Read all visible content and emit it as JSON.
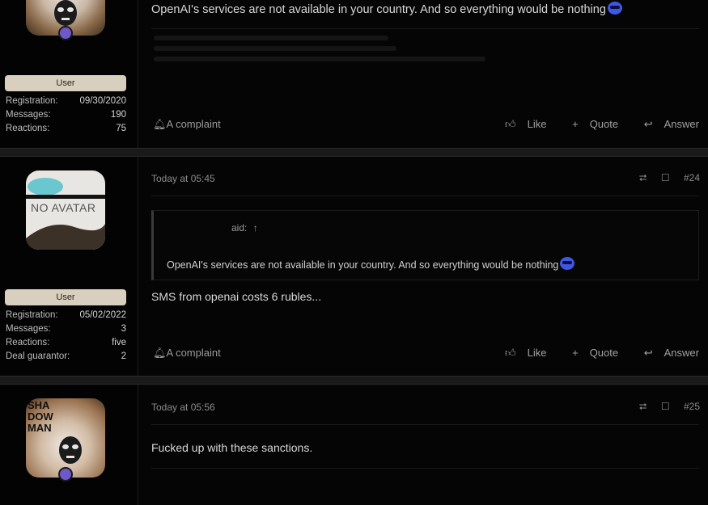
{
  "post1": {
    "text": "OpenAI's services are not available in your country. And so everything would be nothing",
    "badge": "User",
    "stats": [
      {
        "k": "Registration:",
        "v": "09/30/2020"
      },
      {
        "k": "Messages:",
        "v": "190"
      },
      {
        "k": "Reactions:",
        "v": "75"
      }
    ]
  },
  "post2": {
    "avatar_text": "NO AVATAR",
    "date": "Today at 05:45",
    "number": "#24",
    "quote_said": "aid:",
    "quote_text": "OpenAI's services are not available in your country. And so everything would be nothing",
    "text": "SMS from openai costs 6 rubles...",
    "badge": "User",
    "stats": [
      {
        "k": "Registration:",
        "v": "05/02/2022"
      },
      {
        "k": "Messages:",
        "v": "3"
      },
      {
        "k": "Reactions:",
        "v": "five"
      },
      {
        "k": "Deal guarantor:",
        "v": "2"
      }
    ]
  },
  "post3": {
    "avatar_text": "SHA\nDOW\nMAN",
    "date": "Today at 05:56",
    "number": "#25",
    "text": "Fucked up with these sanctions."
  },
  "actions": {
    "complaint": "A complaint",
    "like": "Like",
    "quote": "Quote",
    "answer": "Answer"
  },
  "icons": {
    "share": "share-icon",
    "bookmark": "bookmark-icon",
    "bell": "bell-icon",
    "thumb": "thumbs-up-icon",
    "plus": "plus-icon",
    "reply": "reply-icon",
    "emoji": "sunglasses-emoji"
  },
  "colors": {
    "background": "#000000",
    "badge": "#d9cfbe",
    "emoji": "#3e57e6"
  }
}
